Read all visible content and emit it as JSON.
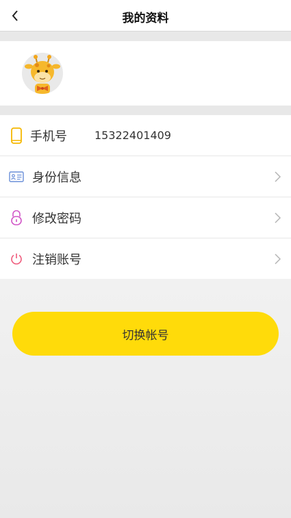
{
  "header": {
    "title": "我的资料"
  },
  "profile": {
    "avatar_icon": "giraffe-avatar-icon"
  },
  "rows": [
    {
      "label": "手机号",
      "value": "15322401409",
      "icon": "phone-icon",
      "color": "#f5b700"
    },
    {
      "label": "身份信息",
      "icon": "id-card-icon",
      "color": "#6a8fd8"
    },
    {
      "label": "修改密码",
      "icon": "lock-icon",
      "color": "#d156c7"
    },
    {
      "label": "注销账号",
      "icon": "power-icon",
      "color": "#ef5a7b"
    }
  ],
  "actions": {
    "switch_account": "切换帐号"
  },
  "colors": {
    "accent": "#ffdb0a"
  }
}
